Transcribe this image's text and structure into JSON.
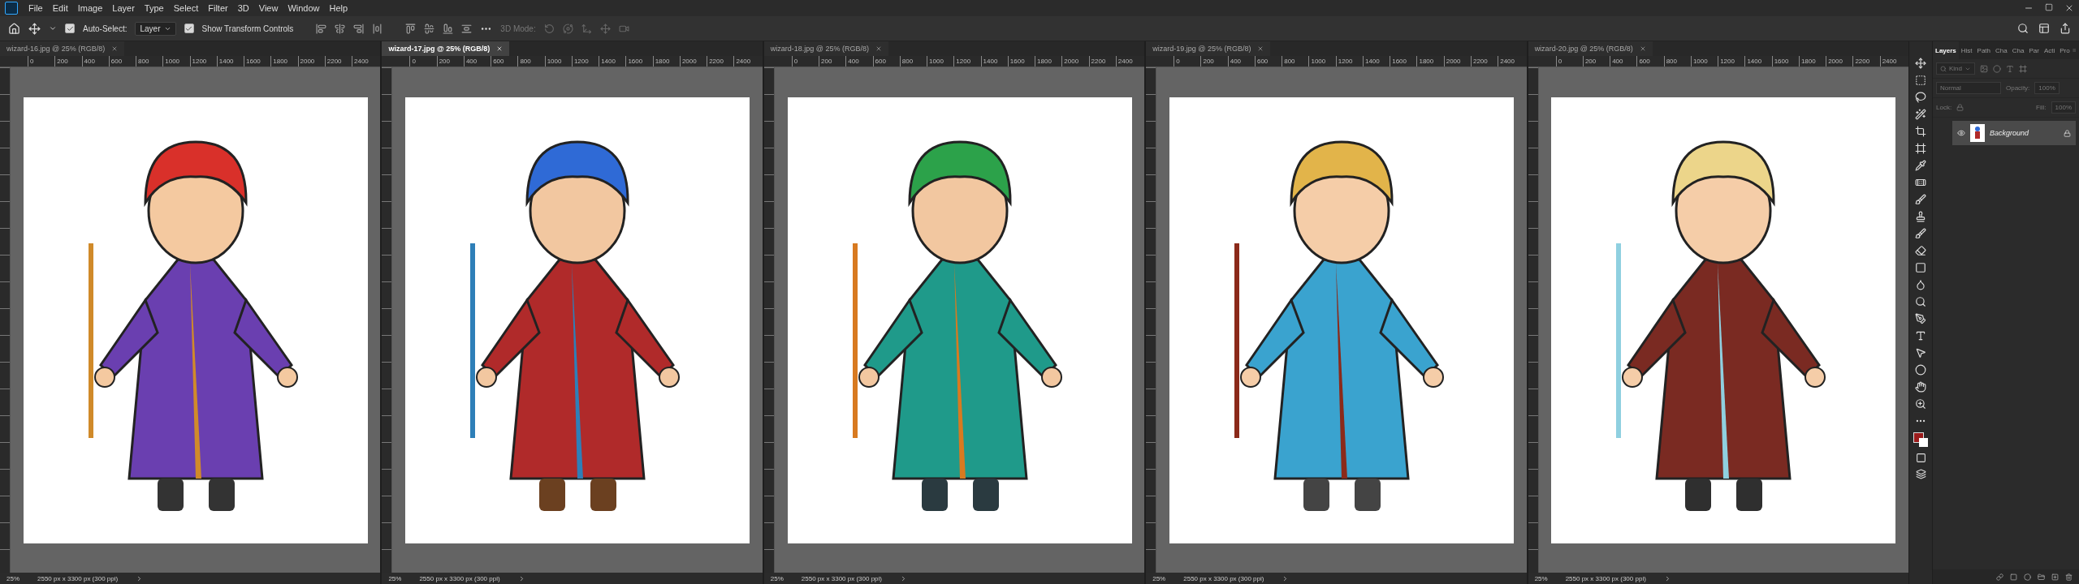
{
  "menu": [
    "File",
    "Edit",
    "Image",
    "Layer",
    "Type",
    "Select",
    "Filter",
    "3D",
    "View",
    "Window",
    "Help"
  ],
  "options_bar": {
    "auto_select": {
      "label": "Auto-Select:",
      "checked": true
    },
    "target": "Layer",
    "transform_controls": {
      "label": "Show Transform Controls",
      "checked": true
    },
    "mode_label": "3D Mode:"
  },
  "documents": [
    {
      "tab": "wizard-16.jpg @ 25% (RGB/8)",
      "selected": false,
      "ruler": [
        "0",
        "200",
        "400",
        "600",
        "800",
        "1000",
        "1200",
        "1400",
        "1600",
        "1800",
        "2000",
        "2200",
        "2400"
      ],
      "zoom": "25%",
      "info": "2550 px x 3300 px (300 ppi)"
    },
    {
      "tab": "wizard-17.jpg @ 25% (RGB/8)",
      "selected": true,
      "ruler": [
        "0",
        "200",
        "400",
        "600",
        "800",
        "1000",
        "1200",
        "1400",
        "1600",
        "1800",
        "2000",
        "2200",
        "2400"
      ],
      "zoom": "25%",
      "info": "2550 px x 3300 px (300 ppi)"
    },
    {
      "tab": "wizard-18.jpg @ 25% (RGB/8)",
      "selected": false,
      "ruler": [
        "0",
        "200",
        "400",
        "600",
        "800",
        "1000",
        "1200",
        "1400",
        "1600",
        "1800",
        "2000",
        "2200",
        "2400"
      ],
      "zoom": "25%",
      "info": "2550 px x 3300 px (300 ppi)"
    },
    {
      "tab": "wizard-19.jpg @ 25% (RGB/8)",
      "selected": false,
      "ruler": [
        "0",
        "200",
        "400",
        "600",
        "800",
        "1000",
        "1200",
        "1400",
        "1600",
        "1800",
        "2000",
        "2200",
        "2400"
      ],
      "zoom": "25%",
      "info": "2550 px x 3300 px (300 ppi)"
    },
    {
      "tab": "wizard-20.jpg @ 25% (RGB/8)",
      "selected": false,
      "ruler": [
        "0",
        "200",
        "400",
        "600",
        "800",
        "1000",
        "1200",
        "1400",
        "1600",
        "1800",
        "2000",
        "2200",
        "2400"
      ],
      "zoom": "25%",
      "info": "2550 px x 3300 px (300 ppi)"
    }
  ],
  "layers_panel": {
    "tabs": [
      {
        "label": "Layers",
        "selected": true
      },
      {
        "label": "Hist",
        "selected": false
      },
      {
        "label": "Path",
        "selected": false
      },
      {
        "label": "Cha",
        "selected": false
      },
      {
        "label": "Cha",
        "selected": false
      },
      {
        "label": "Par",
        "selected": false
      },
      {
        "label": "Acti",
        "selected": false
      },
      {
        "label": "Pro",
        "selected": false
      }
    ],
    "filter": {
      "placeholder": "Kind"
    },
    "blend_mode": "Normal",
    "opacity_label": "Opacity:",
    "opacity": "100%",
    "lock_label": "Lock:",
    "fill_label": "Fill:",
    "fill": "100%",
    "layers": [
      {
        "name": "Background",
        "visible": true
      }
    ]
  }
}
